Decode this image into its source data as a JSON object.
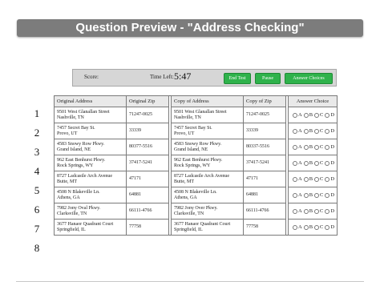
{
  "header": {
    "title": "Question Preview - \"Address Checking\""
  },
  "controls": {
    "score_label": "Score:",
    "time_label": "Time Left:",
    "time_value": "5:47",
    "end_test": "End Test",
    "pause": "Pause",
    "answer_choices": "Answer Choices"
  },
  "table": {
    "columns": [
      "Original Address",
      "Original Zip",
      "Copy of Address",
      "Copy of Zip",
      "Answer Choice"
    ],
    "choices": [
      "A",
      "B",
      "C",
      "D"
    ],
    "rows": [
      {
        "num": "1",
        "orig_addr_1": "9501 West Glanallan Street",
        "orig_addr_2": "Nashville, TN",
        "orig_zip": "71247-0025",
        "copy_addr_1": "9501 West Glanallan Street",
        "copy_addr_2": "Nashville, TN",
        "copy_zip": "71247-0025"
      },
      {
        "num": "2",
        "orig_addr_1": "7457 Secret Bay St.",
        "orig_addr_2": "Provo, UT",
        "orig_zip": "33339",
        "copy_addr_1": "7457 Secret Bay St.",
        "copy_addr_2": "Provo, UT",
        "copy_zip": "33339"
      },
      {
        "num": "3",
        "orig_addr_1": "4583 Snowy Row Pkwy.",
        "orig_addr_2": "Grand Island, NE",
        "orig_zip": "80377-5516",
        "copy_addr_1": "4583 Snowy Row Pkwy.",
        "copy_addr_2": "Grand Island, NE",
        "copy_zip": "80337-5516"
      },
      {
        "num": "4",
        "orig_addr_1": "962 East Benhurst Pkwy.",
        "orig_addr_2": "Rock Springs, WY",
        "orig_zip": "37417-5241",
        "copy_addr_1": "962 East Benhurst Pkwy.",
        "copy_addr_2": "Rock Springs, WY",
        "copy_zip": "37417-5241"
      },
      {
        "num": "5",
        "orig_addr_1": "8727 Ladcastle Arch Avenue",
        "orig_addr_2": "Butte, MT",
        "orig_zip": "47171",
        "copy_addr_1": "8727 Ladcastle Arch Avenue",
        "copy_addr_2": "Butte, MT",
        "copy_zip": "47171"
      },
      {
        "num": "6",
        "orig_addr_1": "4508 N Blakeville Ln.",
        "orig_addr_2": "Athens, GA",
        "orig_zip": "64881",
        "copy_addr_1": "4508 N Blakeville Ln.",
        "copy_addr_2": "Athens, GA",
        "copy_zip": "64881"
      },
      {
        "num": "7",
        "orig_addr_1": "7982 Jony Oval Pkwy.",
        "orig_addr_2": "Clarksville, TN",
        "orig_zip": "66111-4766",
        "copy_addr_1": "7982 Jony Over Pkwy.",
        "copy_addr_2": "Clarksville, TN",
        "copy_zip": "66111-4766"
      },
      {
        "num": "8",
        "orig_addr_1": "3677 Hanaor Quadrant Court",
        "orig_addr_2": "Springfield, IL",
        "orig_zip": "77758",
        "copy_addr_1": "3677 Hanaor Quadrant Court",
        "copy_addr_2": "Springfield, IL",
        "copy_zip": "77758"
      }
    ]
  }
}
